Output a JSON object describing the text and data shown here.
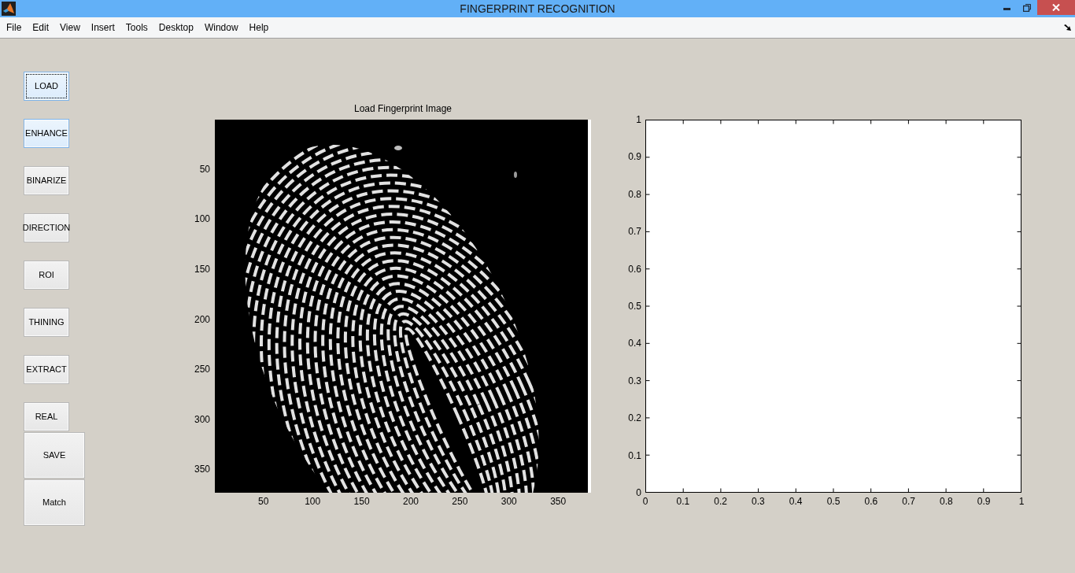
{
  "window": {
    "title": "FINGERPRINT RECOGNITION"
  },
  "menu_bar": [
    "File",
    "Edit",
    "View",
    "Insert",
    "Tools",
    "Desktop",
    "Window",
    "Help"
  ],
  "buttons": [
    {
      "label": "LOAD",
      "kind": "small",
      "highlighted": true,
      "focused": true
    },
    {
      "label": "ENHANCE",
      "kind": "small",
      "highlighted": true,
      "focused": false
    },
    {
      "label": "BINARIZE",
      "kind": "small",
      "highlighted": false,
      "focused": false
    },
    {
      "label": "DIRECTION",
      "kind": "small",
      "highlighted": false,
      "focused": false
    },
    {
      "label": "ROI",
      "kind": "small",
      "highlighted": false,
      "focused": false
    },
    {
      "label": "THINING",
      "kind": "small",
      "highlighted": false,
      "focused": false
    },
    {
      "label": "EXTRACT",
      "kind": "small",
      "highlighted": false,
      "focused": false
    },
    {
      "label": "REAL",
      "kind": "small",
      "highlighted": false,
      "focused": false
    },
    {
      "label": "SAVE",
      "kind": "large",
      "highlighted": false,
      "focused": false
    },
    {
      "label": "Match",
      "kind": "large",
      "highlighted": false,
      "focused": false
    }
  ],
  "image_axes": {
    "title": "Load Fingerprint Image",
    "yticks": [
      "50",
      "100",
      "150",
      "200",
      "250",
      "300",
      "350"
    ],
    "xticks": [
      "50",
      "100",
      "150",
      "200",
      "250",
      "300",
      "350"
    ]
  },
  "empty_axes": {
    "yticks": [
      "1",
      "0.9",
      "0.8",
      "0.7",
      "0.6",
      "0.5",
      "0.4",
      "0.3",
      "0.2",
      "0.1",
      "0"
    ],
    "xticks": [
      "0",
      "0.1",
      "0.2",
      "0.3",
      "0.4",
      "0.5",
      "0.6",
      "0.7",
      "0.8",
      "0.9",
      "1"
    ]
  }
}
